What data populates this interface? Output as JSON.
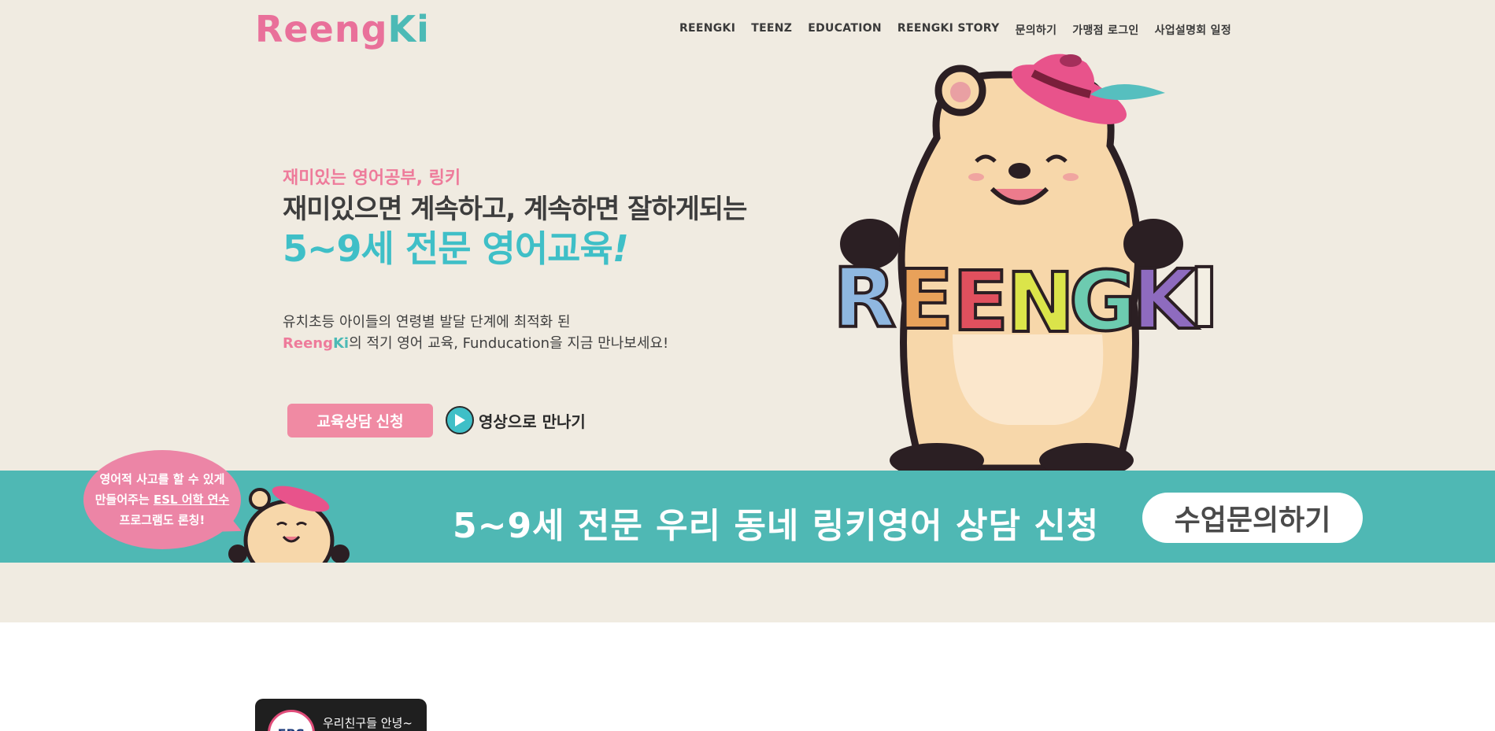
{
  "header": {
    "logo_part1": "Reeng",
    "logo_part2": "Ki",
    "nav": [
      "REENGKI",
      "TEENZ",
      "EDUCATION",
      "REENGKI STORY",
      "문의하기",
      "가맹점 로그인",
      "사업설명회 일정"
    ]
  },
  "hero": {
    "eyebrow": "재미있는 영어공부, 링키",
    "headline": "재미있으면 계속하고, 계속하면 잘하게되는",
    "headline_accent": "5~9세 전문 영어교육",
    "headline_accent_mark": "!",
    "desc_line1": "유치초등 아이들의 연령별 발달 단계에 최적화 된",
    "desc_brand1": "Reeng",
    "desc_brand2": "Ki",
    "desc_line2_rest": "의 적기 영어 교육, Funducation을 지금 만나보세요!",
    "consult_button": "교육상담 신청",
    "video_button": "영상으로 만나기"
  },
  "mascot": {
    "letters": [
      "R",
      "E",
      "E",
      "N",
      "G",
      "K",
      "I"
    ],
    "letter_colors": [
      "#8fb7e0",
      "#e8a15a",
      "#e0505e",
      "#dbe44a",
      "#6dcbb0",
      "#8e6bbf",
      "#f3efe3"
    ]
  },
  "banner": {
    "bubble_line1": "영어적 사고를 할 수 있게",
    "bubble_line2_pre": "만들어주는 ",
    "bubble_line2_u": "ESL 어학 연수",
    "bubble_line3": "프로그램도 론칭!",
    "text": "5~9세 전문 우리 동네 링키영어 상담 신청",
    "button": "수업문의하기"
  },
  "video_card": {
    "avatar_text": "EBS",
    "title": "우리친구들 안녕~"
  },
  "colors": {
    "hero_bg": "#f0ebe1",
    "pink": "#ee7b9b",
    "teal": "#3fbfc7",
    "banner": "#4fb8b4"
  }
}
